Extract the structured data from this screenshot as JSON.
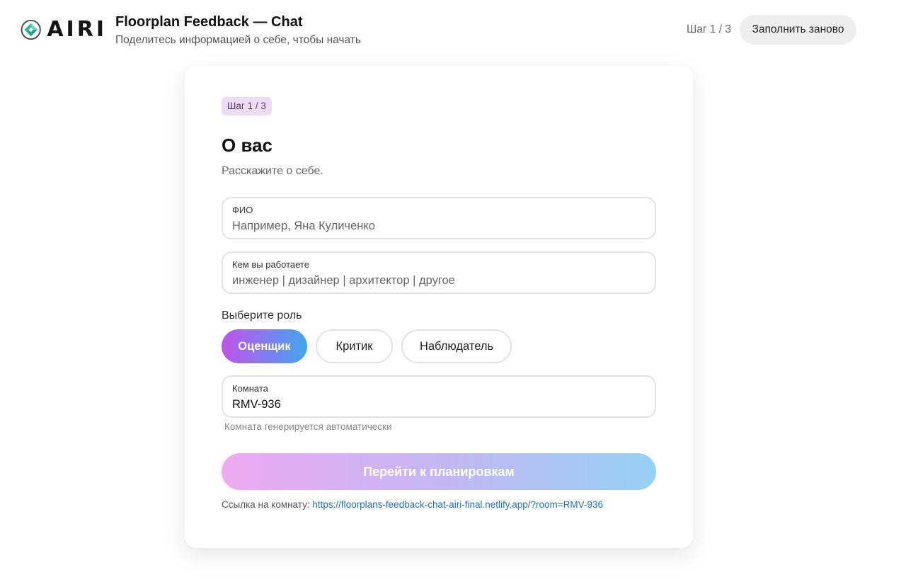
{
  "header": {
    "logo_text": "AIRI",
    "title": "Floorplan Feedback — Chat",
    "subtitle": "Поделитесь информацией о себе, чтобы начать",
    "step": "Шаг 1 / 3",
    "reset_label": "Заполнить заново"
  },
  "card": {
    "step_pill": "Шаг 1 / 3",
    "title": "О вас",
    "description": "Расскажите о себе.",
    "name_field": {
      "label": "ФИО",
      "value": "",
      "placeholder": "Например, Яна Куличенко"
    },
    "job_field": {
      "label": "Кем вы работаете",
      "value": "",
      "placeholder": "инженер | дизайнер | архитектор | другое"
    },
    "role_label": "Выберите роль",
    "roles": [
      {
        "label": "Оценщик",
        "selected": true
      },
      {
        "label": "Критик",
        "selected": false
      },
      {
        "label": "Наблюдатель",
        "selected": false
      }
    ],
    "room_field": {
      "label": "Комната",
      "value": "RMV-936"
    },
    "room_hint": "Комната генерируется автоматически",
    "go_label": "Перейти к планировкам",
    "link_prefix": "Ссылка на комнату:",
    "link_url": "https://floorplans-feedback-chat-airi-final.netlify.app/?room=RMV-936"
  },
  "colors": {
    "accent_start": "#c153e8",
    "accent_end": "#3fa8ee",
    "pill_bg": "#ecdcf5",
    "link": "#1f6fc4"
  },
  "icons": {
    "logo": "airi-logo-icon"
  }
}
